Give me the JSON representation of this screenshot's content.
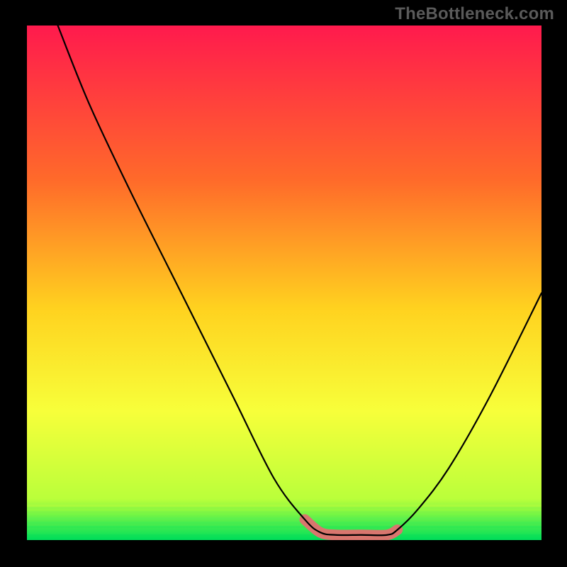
{
  "watermark": "TheBottleneck.com",
  "chart_data": {
    "type": "line",
    "title": "",
    "xlabel": "",
    "ylabel": "",
    "xlim": [
      0,
      100
    ],
    "ylim": [
      0,
      100
    ],
    "grid": false,
    "legend": false,
    "background": {
      "type": "vertical-gradient",
      "stops": [
        {
          "offset": 0,
          "color": "#ff1a4d"
        },
        {
          "offset": 30,
          "color": "#ff6a2a"
        },
        {
          "offset": 55,
          "color": "#ffd21f"
        },
        {
          "offset": 75,
          "color": "#f7ff3a"
        },
        {
          "offset": 92,
          "color": "#baff3a"
        },
        {
          "offset": 100,
          "color": "#00e05a"
        }
      ]
    },
    "series": [
      {
        "name": "bottleneck-curve",
        "color": "#000000",
        "x": [
          6,
          12,
          20,
          30,
          40,
          48,
          54,
          57,
          60,
          65,
          70,
          72,
          76,
          82,
          90,
          100
        ],
        "y": [
          100,
          85,
          68,
          48,
          28,
          12,
          4,
          1.5,
          1,
          1,
          1,
          2,
          6,
          14,
          28,
          48
        ]
      },
      {
        "name": "tolerance-band",
        "color": "#d9766e",
        "x": [
          54,
          57,
          60,
          65,
          70,
          72
        ],
        "y": [
          4,
          1.5,
          1,
          1,
          1,
          2
        ]
      }
    ],
    "annotations": []
  }
}
